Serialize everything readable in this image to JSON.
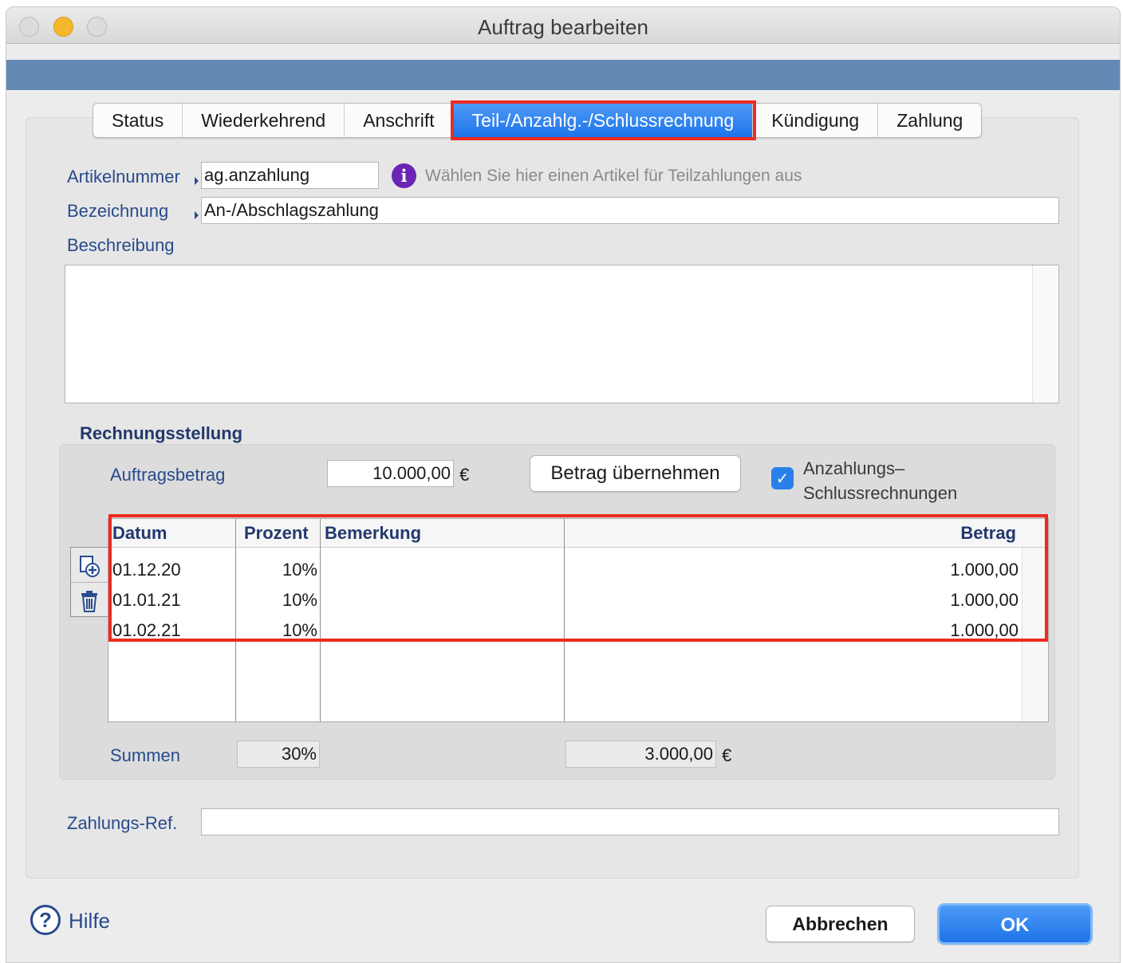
{
  "window": {
    "title": "Auftrag bearbeiten"
  },
  "tabs": [
    {
      "label": "Status"
    },
    {
      "label": "Wiederkehrend"
    },
    {
      "label": "Anschrift"
    },
    {
      "label": "Teil-/Anzahlg.-/Schlussrechnung",
      "active": true
    },
    {
      "label": "Kündigung"
    },
    {
      "label": "Zahlung"
    }
  ],
  "form": {
    "artikelnummer_label": "Artikelnummer",
    "artikelnummer_value": "ag.anzahlung",
    "info_hint": "Wählen Sie hier einen Artikel für Teilzahlungen aus",
    "bezeichnung_label": "Bezeichnung",
    "bezeichnung_value": "An-/Abschlagszahlung",
    "beschreibung_label": "Beschreibung",
    "beschreibung_value": "",
    "zahlungsref_label": "Zahlungs-Ref.",
    "zahlungsref_value": ""
  },
  "rechnungsstellung": {
    "title": "Rechnungsstellung",
    "auftragsbetrag_label": "Auftragsbetrag",
    "auftragsbetrag_value": "10.000,00",
    "currency": "€",
    "betrag_button": "Betrag übernehmen",
    "checkbox_checked": true,
    "checkbox_label_line1": "Anzahlungs–",
    "checkbox_label_line2": "Schlussrechnungen",
    "table": {
      "headers": {
        "datum": "Datum",
        "prozent": "Prozent",
        "bemerkung": "Bemerkung",
        "betrag": "Betrag"
      },
      "rows": [
        {
          "datum": "01.12.20",
          "prozent": "10%",
          "bemerkung": "",
          "betrag": "1.000,00"
        },
        {
          "datum": "01.01.21",
          "prozent": "10%",
          "bemerkung": "",
          "betrag": "1.000,00"
        },
        {
          "datum": "01.02.21",
          "prozent": "10%",
          "bemerkung": "",
          "betrag": "1.000,00"
        }
      ]
    },
    "summen_label": "Summen",
    "summen_prozent": "30%",
    "summen_betrag": "3.000,00"
  },
  "footer": {
    "help_icon": "?",
    "help_label": "Hilfe",
    "cancel_label": "Abbrechen",
    "ok_label": "OK"
  },
  "icons": {
    "info": "info-icon",
    "add_row": "add-row-icon",
    "delete_row": "trash-icon",
    "checkmark": "checkmark-icon"
  },
  "colors": {
    "accent_blue": "#1f73e8",
    "header_band": "#6489b5",
    "label_blue": "#284a8c",
    "highlight_red": "#ee2b1e",
    "info_purple": "#6a25b5"
  }
}
